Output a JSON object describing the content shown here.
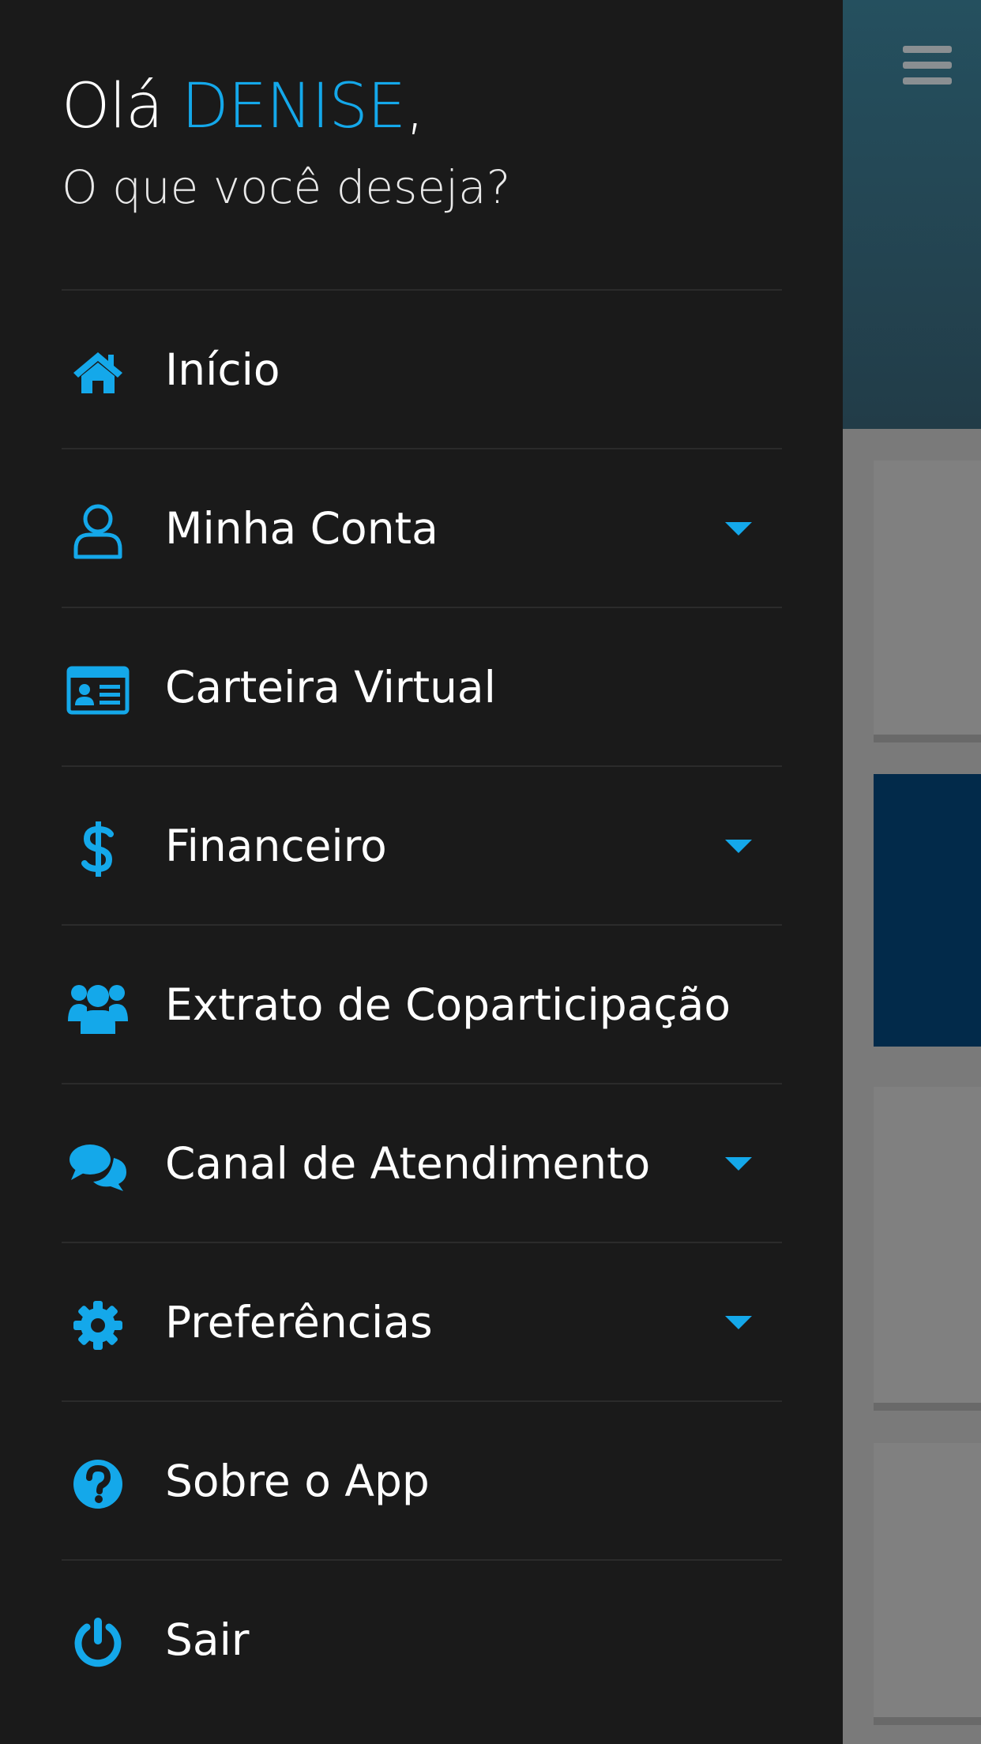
{
  "drawer": {
    "greeting_prefix": "Olá ",
    "user_name": "DENISE",
    "greeting_suffix": ",",
    "subtitle": "O que você deseja?",
    "items": [
      {
        "label": "Início",
        "icon": "home-icon",
        "has_submenu": false
      },
      {
        "label": "Minha Conta",
        "icon": "user-icon",
        "has_submenu": true
      },
      {
        "label": "Carteira Virtual",
        "icon": "id-card-icon",
        "has_submenu": false
      },
      {
        "label": "Financeiro",
        "icon": "dollar-icon",
        "has_submenu": true
      },
      {
        "label": "Extrato de Coparticipação",
        "icon": "users-icon",
        "has_submenu": false
      },
      {
        "label": "Canal de Atendimento",
        "icon": "chat-icon",
        "has_submenu": true
      },
      {
        "label": "Preferências",
        "icon": "gear-icon",
        "has_submenu": true
      },
      {
        "label": "Sobre o App",
        "icon": "question-icon",
        "has_submenu": false
      },
      {
        "label": "Sair",
        "icon": "power-icon",
        "has_submenu": false
      }
    ]
  },
  "background": {
    "menu_icon": "hamburger-icon"
  },
  "colors": {
    "accent": "#14a8ea",
    "drawer_bg": "#1a1a1a",
    "text": "#ffffff"
  }
}
